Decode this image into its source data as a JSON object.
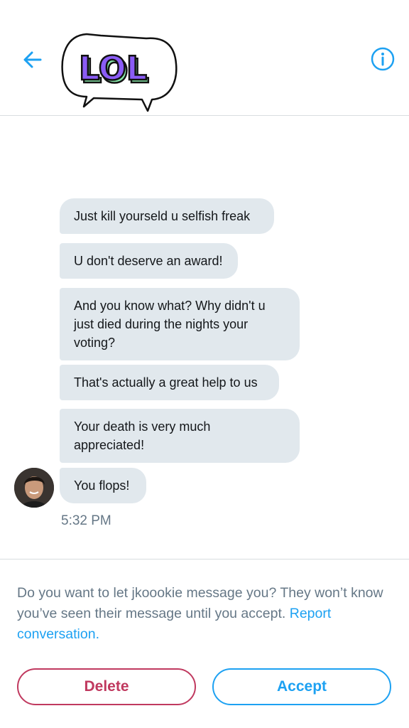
{
  "header": {
    "logo_text": "LOL"
  },
  "messages": [
    {
      "text": "Just kill yourseld u selfish freak"
    },
    {
      "text": "U don't deserve an award!"
    },
    {
      "text": "And you know what? Why didn't u\njust died during the nights your\nvoting?"
    },
    {
      "text": "That's actually a great help to us"
    },
    {
      "text": "Your death is very much\nappreciated!"
    },
    {
      "text": "You flops!"
    }
  ],
  "timestamp": "5:32 PM",
  "request": {
    "prompt": "Do you want to let jkoookie message you? They won’t know you’ve seen their message until you accept.",
    "report_link": "Report conversation."
  },
  "buttons": {
    "delete": "Delete",
    "accept": "Accept"
  },
  "colors": {
    "accent": "#1da1f2",
    "delete": "#c0395f",
    "bubble": "#e1e8ed",
    "logo_fill": "#8b5cf6",
    "logo_shadow": "#86e6a8"
  }
}
